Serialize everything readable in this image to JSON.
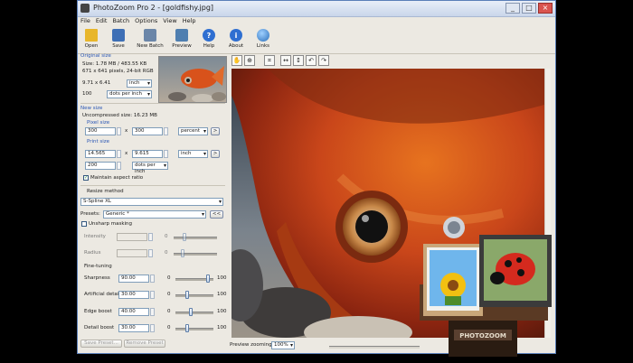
{
  "window": {
    "title": "PhotoZoom Pro 2 - [goldfishy.jpg]",
    "controls": [
      "_",
      "□",
      "×"
    ]
  },
  "menu": [
    "File",
    "Edit",
    "Batch",
    "Options",
    "View",
    "Help"
  ],
  "toolbar": [
    {
      "label": "Open",
      "icon": "folder-icon",
      "color": "#e8b62a"
    },
    {
      "label": "Save",
      "icon": "floppy-icon",
      "color": "#3e6fb5"
    },
    {
      "label": "New Batch",
      "icon": "batch-icon",
      "color": "#6b86a8"
    },
    {
      "label": "Preview",
      "icon": "preview-icon",
      "color": "#4f7fb0"
    },
    {
      "label": "Help",
      "icon": "help-icon",
      "color": "#2f6fd1"
    },
    {
      "label": "About",
      "icon": "info-icon",
      "color": "#2f6fd1"
    },
    {
      "label": "Links",
      "icon": "globe-icon",
      "color": "#3b82c8"
    }
  ],
  "original": {
    "section": "Original size",
    "size_line": "Size: 1.78 MB / 483.55 KB",
    "pixels_line": "671 x 641 pixels, 24-bit RGB",
    "dims": "9.71 x 6.41",
    "dims_unit": "inch",
    "resolution": "100",
    "resolution_unit": "dots per inch"
  },
  "new_size": {
    "section": "New size",
    "uncompressed": "Uncompressed size: 16.23 MB",
    "pixel_section": "Pixel size",
    "pixel_w": "300",
    "pixel_h": "300",
    "pixel_unit": "percent",
    "print_section": "Print size",
    "print_w": "14.565",
    "print_h": "9.615",
    "print_unit": "inch",
    "print_res": "200",
    "print_res_unit": "dots per inch",
    "x_sep": "x",
    "more": ">",
    "maintain_label": "Maintain aspect ratio",
    "maintain_checked": true
  },
  "resize": {
    "section": "Resize method",
    "method": "S-Spline XL",
    "presets_label": "Presets:",
    "preset": "Generic *",
    "more_btn": "<<"
  },
  "unsharp": {
    "label": "Unsharp masking",
    "intensity_label": "Intensity",
    "radius_label": "Radius",
    "zero": "0"
  },
  "finetune": {
    "section": "Fine-tuning",
    "rows": [
      {
        "label": "Sharpness",
        "value": "90.00",
        "min": "0",
        "max": "100",
        "level": 0.9
      },
      {
        "label": "Artificial detail",
        "value": "30.00",
        "min": "0",
        "max": "100",
        "level": 0.3
      },
      {
        "label": "Edge boost",
        "value": "40.00",
        "min": "0",
        "max": "100",
        "level": 0.4
      },
      {
        "label": "Detail boost",
        "value": "30.00",
        "min": "0",
        "max": "100",
        "level": 0.3
      }
    ]
  },
  "buttons": {
    "save_preset": "Save Preset...",
    "remove_preset": "Remove Preset"
  },
  "preview": {
    "zoom_label": "Preview zooming:",
    "zoom_value": "100%"
  },
  "logo": {
    "text": "PHOTOZOOM"
  }
}
